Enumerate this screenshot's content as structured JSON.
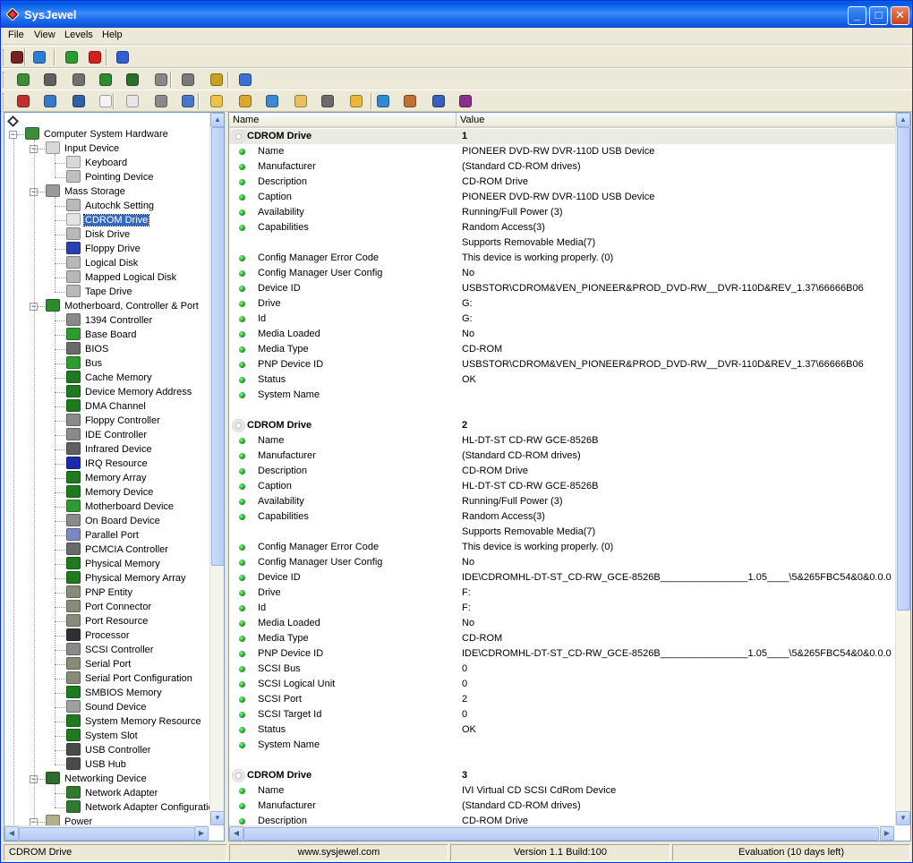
{
  "window": {
    "title": "SysJewel"
  },
  "menu": [
    "File",
    "View",
    "Levels",
    "Help"
  ],
  "toolbars": {
    "row1": [
      {
        "icon": "diamond-icon",
        "color": "#7a1f1f"
      },
      {
        "icon": "globe-icon",
        "color": "#2a7fd4"
      },
      {
        "icon": "refresh-icon",
        "color": "#2f9a2f"
      },
      {
        "icon": "stop-icon",
        "color": "#d42020"
      },
      {
        "icon": "info-icon",
        "color": "#2f5fd4"
      }
    ],
    "row2": [
      {
        "icon": "hardware-icon",
        "color": "#3c8c3c"
      },
      {
        "icon": "input-device-icon",
        "color": "#606060"
      },
      {
        "icon": "mass-storage-icon",
        "color": "#707070"
      },
      {
        "icon": "motherboard-icon",
        "color": "#2e8b2e"
      },
      {
        "icon": "network-icon",
        "color": "#2e6b2e"
      },
      {
        "icon": "power-icon",
        "color": "#888888"
      },
      {
        "icon": "printer-icon",
        "color": "#7a7a7a"
      },
      {
        "icon": "video-icon",
        "color": "#c9a020"
      },
      {
        "icon": "software-icon",
        "color": "#3b6fd4"
      }
    ],
    "row3": [
      {
        "icon": "app-icon",
        "color": "#c03030"
      },
      {
        "icon": "search-icon",
        "color": "#3a78c8"
      },
      {
        "icon": "process-icon",
        "color": "#2f5fa8"
      },
      {
        "icon": "document-icon",
        "color": "#f4f4f4"
      },
      {
        "icon": "copy-icon",
        "color": "#e8e8e8"
      },
      {
        "icon": "registry-icon",
        "color": "#8a8a8a"
      },
      {
        "icon": "network-share-icon",
        "color": "#4a78c8"
      },
      {
        "icon": "folder-icon",
        "color": "#e8c44a"
      },
      {
        "icon": "download-icon",
        "color": "#d8a830"
      },
      {
        "icon": "tools-icon",
        "color": "#3a8ad4"
      },
      {
        "icon": "mail-icon",
        "color": "#e8c060"
      },
      {
        "icon": "gear-icon",
        "color": "#6a6a6a"
      },
      {
        "icon": "folder-open-icon",
        "color": "#e8b83a"
      },
      {
        "icon": "windows-icon",
        "color": "#2f8ad4"
      },
      {
        "icon": "users-icon",
        "color": "#c07030"
      },
      {
        "icon": "report-icon",
        "color": "#3a5fb8"
      },
      {
        "icon": "chart-icon",
        "color": "#8a2f8a"
      }
    ]
  },
  "tree": {
    "root": "Computer System Hardware",
    "groups": [
      {
        "label": "Input Device",
        "icon": "keyboard-icon",
        "children": [
          {
            "label": "Keyboard",
            "icon": "keyboard-icon"
          },
          {
            "label": "Pointing Device",
            "icon": "mouse-icon"
          }
        ]
      },
      {
        "label": "Mass Storage",
        "icon": "mass-storage-icon",
        "children": [
          {
            "label": "Autochk Setting",
            "icon": "drive-icon"
          },
          {
            "label": "CDROM Drive",
            "icon": "cd-icon",
            "selected": true
          },
          {
            "label": "Disk Drive",
            "icon": "drive-icon"
          },
          {
            "label": "Floppy Drive",
            "icon": "floppy-icon"
          },
          {
            "label": "Logical Disk",
            "icon": "drive-icon"
          },
          {
            "label": "Mapped Logical Disk",
            "icon": "drive-icon"
          },
          {
            "label": "Tape Drive",
            "icon": "drive-icon"
          }
        ]
      },
      {
        "label": "Motherboard, Controller & Port",
        "icon": "motherboard-icon",
        "children": [
          {
            "label": "1394 Controller",
            "icon": "cable-icon"
          },
          {
            "label": "Base Board",
            "icon": "board-icon"
          },
          {
            "label": "BIOS",
            "icon": "chip-icon"
          },
          {
            "label": "Bus",
            "icon": "board-icon"
          },
          {
            "label": "Cache Memory",
            "icon": "memory-icon"
          },
          {
            "label": "Device Memory Address",
            "icon": "memory-icon"
          },
          {
            "label": "DMA Channel",
            "icon": "memory-icon"
          },
          {
            "label": "Floppy Controller",
            "icon": "cable-icon"
          },
          {
            "label": "IDE Controller",
            "icon": "cable-icon"
          },
          {
            "label": "Infrared Device",
            "icon": "infrared-icon"
          },
          {
            "label": "IRQ Resource",
            "icon": "irq-icon"
          },
          {
            "label": "Memory Array",
            "icon": "memory-icon"
          },
          {
            "label": "Memory Device",
            "icon": "memory-icon"
          },
          {
            "label": "Motherboard Device",
            "icon": "board-icon"
          },
          {
            "label": "On Board Device",
            "icon": "cable-icon"
          },
          {
            "label": "Parallel Port",
            "icon": "port-icon"
          },
          {
            "label": "PCMCIA Controller",
            "icon": "chip-icon"
          },
          {
            "label": "Physical Memory",
            "icon": "memory-icon"
          },
          {
            "label": "Physical Memory Array",
            "icon": "memory-icon"
          },
          {
            "label": "PNP Entity",
            "icon": "plug-icon"
          },
          {
            "label": "Port Connector",
            "icon": "plug-icon"
          },
          {
            "label": "Port Resource",
            "icon": "plug-icon"
          },
          {
            "label": "Processor",
            "icon": "processor-icon"
          },
          {
            "label": "SCSI Controller",
            "icon": "cable-icon"
          },
          {
            "label": "Serial Port",
            "icon": "plug-icon"
          },
          {
            "label": "Serial Port Configuration",
            "icon": "plug-icon"
          },
          {
            "label": "SMBIOS Memory",
            "icon": "memory-icon"
          },
          {
            "label": "Sound Device",
            "icon": "speaker-icon"
          },
          {
            "label": "System Memory Resource",
            "icon": "memory-icon"
          },
          {
            "label": "System Slot",
            "icon": "memory-icon"
          },
          {
            "label": "USB Controller",
            "icon": "usb-icon"
          },
          {
            "label": "USB Hub",
            "icon": "usb-icon"
          }
        ]
      },
      {
        "label": "Networking Device",
        "icon": "network-icon",
        "children": [
          {
            "label": "Network Adapter",
            "icon": "network-card-icon"
          },
          {
            "label": "Network Adapter Configuratic",
            "icon": "network-card-icon"
          }
        ]
      },
      {
        "label": "Power",
        "icon": "power-icon",
        "children": []
      }
    ]
  },
  "list": {
    "columns": [
      "Name",
      "Value"
    ],
    "rows": [
      {
        "type": "section",
        "name": "CDROM Drive",
        "value": "1",
        "highlight": true
      },
      {
        "type": "prop",
        "name": "Name",
        "value": "PIONEER DVD-RW  DVR-110D USB Device"
      },
      {
        "type": "prop",
        "name": "Manufacturer",
        "value": "(Standard CD-ROM drives)"
      },
      {
        "type": "prop",
        "name": "Description",
        "value": "CD-ROM Drive"
      },
      {
        "type": "prop",
        "name": "Caption",
        "value": "PIONEER DVD-RW  DVR-110D USB Device"
      },
      {
        "type": "prop",
        "name": "Availability",
        "value": "Running/Full Power (3)"
      },
      {
        "type": "prop",
        "name": "Capabilities",
        "value": "Random Access(3)"
      },
      {
        "type": "cont",
        "name": "",
        "value": "Supports Removable Media(7)"
      },
      {
        "type": "prop",
        "name": "Config Manager Error Code",
        "value": "This device is working properly. (0)"
      },
      {
        "type": "prop",
        "name": "Config Manager User Config",
        "value": "No"
      },
      {
        "type": "prop",
        "name": "Device ID",
        "value": "USBSTOR\\CDROM&VEN_PIONEER&PROD_DVD-RW__DVR-110D&REV_1.37\\66666B06"
      },
      {
        "type": "prop",
        "name": "Drive",
        "value": "G:"
      },
      {
        "type": "prop",
        "name": "Id",
        "value": "G:"
      },
      {
        "type": "prop",
        "name": "Media Loaded",
        "value": "No"
      },
      {
        "type": "prop",
        "name": "Media Type",
        "value": "CD-ROM"
      },
      {
        "type": "prop",
        "name": "PNP Device ID",
        "value": "USBSTOR\\CDROM&VEN_PIONEER&PROD_DVD-RW__DVR-110D&REV_1.37\\66666B06"
      },
      {
        "type": "prop",
        "name": "Status",
        "value": "OK"
      },
      {
        "type": "prop",
        "name": "System Name",
        "value": ""
      },
      {
        "type": "blank",
        "name": "",
        "value": ""
      },
      {
        "type": "section",
        "name": "CDROM Drive",
        "value": "2"
      },
      {
        "type": "prop",
        "name": "Name",
        "value": "HL-DT-ST CD-RW GCE-8526B"
      },
      {
        "type": "prop",
        "name": "Manufacturer",
        "value": "(Standard CD-ROM drives)"
      },
      {
        "type": "prop",
        "name": "Description",
        "value": "CD-ROM Drive"
      },
      {
        "type": "prop",
        "name": "Caption",
        "value": "HL-DT-ST CD-RW GCE-8526B"
      },
      {
        "type": "prop",
        "name": "Availability",
        "value": "Running/Full Power (3)"
      },
      {
        "type": "prop",
        "name": "Capabilities",
        "value": "Random Access(3)"
      },
      {
        "type": "cont",
        "name": "",
        "value": "Supports Removable Media(7)"
      },
      {
        "type": "prop",
        "name": "Config Manager Error Code",
        "value": "This device is working properly. (0)"
      },
      {
        "type": "prop",
        "name": "Config Manager User Config",
        "value": "No"
      },
      {
        "type": "prop",
        "name": "Device ID",
        "value": "IDE\\CDROMHL-DT-ST_CD-RW_GCE-8526B________________1.05____\\5&265FBC54&0&0.0.0"
      },
      {
        "type": "prop",
        "name": "Drive",
        "value": "F:"
      },
      {
        "type": "prop",
        "name": "Id",
        "value": "F:"
      },
      {
        "type": "prop",
        "name": "Media Loaded",
        "value": "No"
      },
      {
        "type": "prop",
        "name": "Media Type",
        "value": "CD-ROM"
      },
      {
        "type": "prop",
        "name": "PNP Device ID",
        "value": "IDE\\CDROMHL-DT-ST_CD-RW_GCE-8526B________________1.05____\\5&265FBC54&0&0.0.0"
      },
      {
        "type": "prop",
        "name": "SCSI Bus",
        "value": "0"
      },
      {
        "type": "prop",
        "name": "SCSI Logical Unit",
        "value": "0"
      },
      {
        "type": "prop",
        "name": "SCSI Port",
        "value": "2"
      },
      {
        "type": "prop",
        "name": "SCSI Target Id",
        "value": "0"
      },
      {
        "type": "prop",
        "name": "Status",
        "value": "OK"
      },
      {
        "type": "prop",
        "name": "System Name",
        "value": ""
      },
      {
        "type": "blank",
        "name": "",
        "value": ""
      },
      {
        "type": "section",
        "name": "CDROM Drive",
        "value": "3"
      },
      {
        "type": "prop",
        "name": "Name",
        "value": "IVI Virtual CD SCSI CdRom Device"
      },
      {
        "type": "prop",
        "name": "Manufacturer",
        "value": "(Standard CD-ROM drives)"
      },
      {
        "type": "prop",
        "name": "Description",
        "value": "CD-ROM Drive"
      }
    ]
  },
  "status": {
    "selected": "CDROM Drive",
    "website": "www.sysjewel.com",
    "version": "Version 1.1 Build:100",
    "license": "Evaluation (10 days left)"
  }
}
